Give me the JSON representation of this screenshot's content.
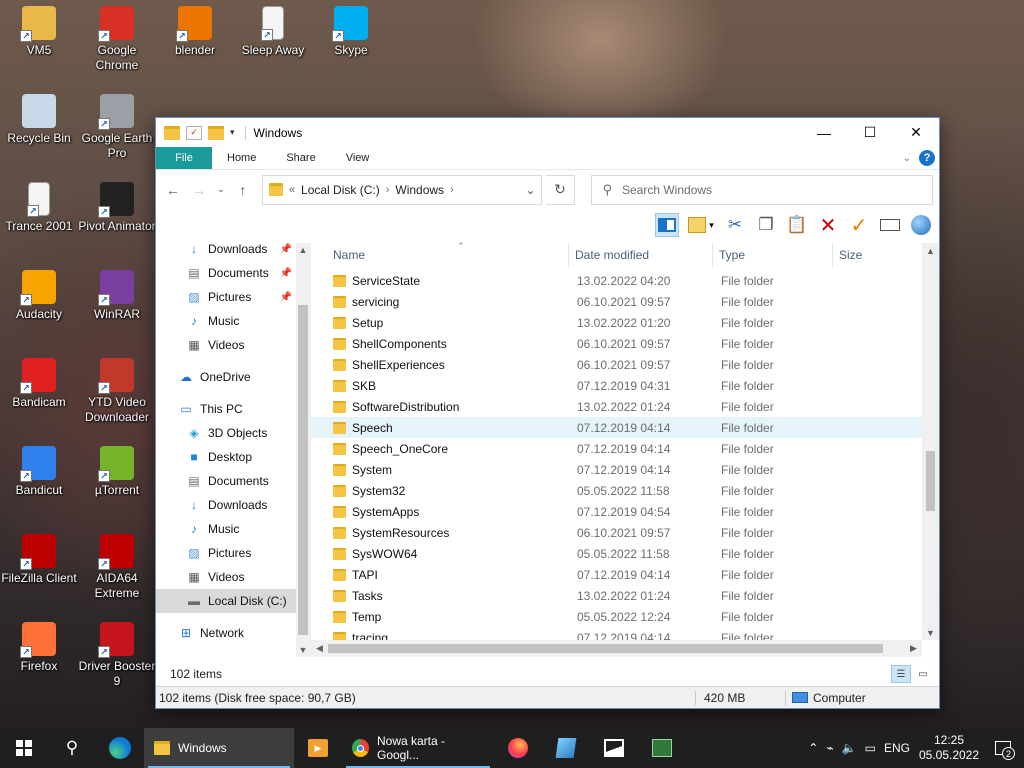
{
  "desktop": {
    "icons": [
      {
        "label": "VM5",
        "icon": "folder-user-icon",
        "color": "#e8b84a"
      },
      {
        "label": "Google Chrome",
        "icon": "chrome-icon",
        "color": "#d93025"
      },
      {
        "label": "blender",
        "icon": "blender-icon",
        "color": "#ea7600"
      },
      {
        "label": "Sleep Away",
        "icon": "document-icon",
        "color": "#f4f4f4"
      },
      {
        "label": "Skype",
        "icon": "skype-icon",
        "color": "#00aff0"
      },
      {
        "label": "Recycle Bin",
        "icon": "recycle-bin-icon",
        "color": "#c9d8e8"
      },
      {
        "label": "Google Earth Pro",
        "icon": "google-earth-icon",
        "color": "#9aa0a6"
      },
      {
        "label": "Trance 2001",
        "icon": "document-icon",
        "color": "#f4f4f4"
      },
      {
        "label": "Pivot Animator",
        "icon": "pivot-icon",
        "color": "#222222"
      },
      {
        "label": "Audacity",
        "icon": "audacity-icon",
        "color": "#f7a400"
      },
      {
        "label": "WinRAR",
        "icon": "winrar-icon",
        "color": "#7a3fa0"
      },
      {
        "label": "Bandicam",
        "icon": "bandicam-icon",
        "color": "#e02020"
      },
      {
        "label": "YTD Video Downloader",
        "icon": "ytd-icon",
        "color": "#c0392b"
      },
      {
        "label": "Bandicut",
        "icon": "bandicut-icon",
        "color": "#2f80ed"
      },
      {
        "label": "µTorrent",
        "icon": "utorrent-icon",
        "color": "#78b42a"
      },
      {
        "label": "FileZilla Client",
        "icon": "filezilla-icon",
        "color": "#bf0000"
      },
      {
        "label": "AIDA64 Extreme",
        "icon": "aida64-icon",
        "color": "#c00000"
      },
      {
        "label": "Firefox",
        "icon": "firefox-icon",
        "color": "#ff7139"
      },
      {
        "label": "Driver Booster 9",
        "icon": "driver-booster-icon",
        "color": "#c4161c"
      }
    ]
  },
  "window": {
    "title": "Windows",
    "ribbon_tabs": [
      "File",
      "Home",
      "Share",
      "View"
    ],
    "address": {
      "root": "Local Disk (C:)",
      "folder": "Windows",
      "chevrons": "«"
    },
    "search_placeholder": "Search Windows",
    "nav": {
      "items": [
        {
          "label": "Downloads",
          "pinned": true,
          "icon": "download-arrow-icon"
        },
        {
          "label": "Documents",
          "pinned": true,
          "icon": "documents-icon"
        },
        {
          "label": "Pictures",
          "pinned": true,
          "icon": "pictures-icon"
        },
        {
          "label": "Music",
          "pinned": false,
          "icon": "music-icon"
        },
        {
          "label": "Videos",
          "pinned": false,
          "icon": "videos-icon"
        },
        {
          "label": "OneDrive",
          "pinned": false,
          "icon": "onedrive-icon"
        },
        {
          "label": "This PC",
          "pinned": false,
          "icon": "this-pc-icon"
        },
        {
          "label": "3D Objects",
          "pinned": false,
          "icon": "3d-objects-icon"
        },
        {
          "label": "Desktop",
          "pinned": false,
          "icon": "desktop-icon"
        },
        {
          "label": "Documents",
          "pinned": false,
          "icon": "documents-icon"
        },
        {
          "label": "Downloads",
          "pinned": false,
          "icon": "download-arrow-icon"
        },
        {
          "label": "Music",
          "pinned": false,
          "icon": "music-icon"
        },
        {
          "label": "Pictures",
          "pinned": false,
          "icon": "pictures-icon"
        },
        {
          "label": "Videos",
          "pinned": false,
          "icon": "videos-icon"
        },
        {
          "label": "Local Disk (C:)",
          "pinned": false,
          "selected": true,
          "icon": "local-disk-icon"
        },
        {
          "label": "Network",
          "pinned": false,
          "icon": "network-icon"
        }
      ]
    },
    "columns": [
      "Name",
      "Date modified",
      "Type",
      "Size"
    ],
    "files": [
      {
        "name": "ServiceState",
        "date": "13.02.2022 04:20",
        "type": "File folder"
      },
      {
        "name": "servicing",
        "date": "06.10.2021 09:57",
        "type": "File folder"
      },
      {
        "name": "Setup",
        "date": "13.02.2022 01:20",
        "type": "File folder"
      },
      {
        "name": "ShellComponents",
        "date": "06.10.2021 09:57",
        "type": "File folder"
      },
      {
        "name": "ShellExperiences",
        "date": "06.10.2021 09:57",
        "type": "File folder"
      },
      {
        "name": "SKB",
        "date": "07.12.2019 04:31",
        "type": "File folder"
      },
      {
        "name": "SoftwareDistribution",
        "date": "13.02.2022 01:24",
        "type": "File folder"
      },
      {
        "name": "Speech",
        "date": "07.12.2019 04:14",
        "type": "File folder",
        "selected": true
      },
      {
        "name": "Speech_OneCore",
        "date": "07.12.2019 04:14",
        "type": "File folder"
      },
      {
        "name": "System",
        "date": "07.12.2019 04:14",
        "type": "File folder"
      },
      {
        "name": "System32",
        "date": "05.05.2022 11:58",
        "type": "File folder"
      },
      {
        "name": "SystemApps",
        "date": "07.12.2019 04:54",
        "type": "File folder"
      },
      {
        "name": "SystemResources",
        "date": "06.10.2021 09:57",
        "type": "File folder"
      },
      {
        "name": "SysWOW64",
        "date": "05.05.2022 11:58",
        "type": "File folder"
      },
      {
        "name": "TAPI",
        "date": "07.12.2019 04:14",
        "type": "File folder"
      },
      {
        "name": "Tasks",
        "date": "13.02.2022 01:24",
        "type": "File folder"
      },
      {
        "name": "Temp",
        "date": "05.05.2022 12:24",
        "type": "File folder"
      },
      {
        "name": "tracing",
        "date": "07.12.2019 04:14",
        "type": "File folder"
      }
    ],
    "item_count": "102 items",
    "status": {
      "summary": "102 items (Disk free space: 90,7 GB)",
      "size": "420 MB",
      "location": "Computer"
    }
  },
  "taskbar": {
    "apps": [
      {
        "label": "Windows",
        "icon": "explorer-icon",
        "active": true
      },
      {
        "label": "Nowa karta - Googl...",
        "icon": "chrome-icon",
        "active": false
      }
    ],
    "tray": {
      "language": "ENG",
      "time": "12:25",
      "date": "05.05.2022",
      "notifications": "2"
    }
  }
}
